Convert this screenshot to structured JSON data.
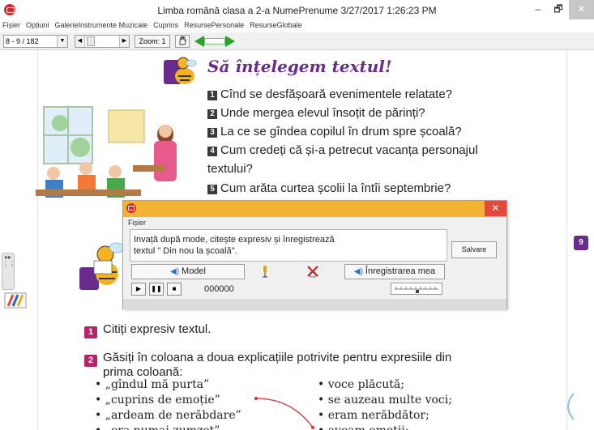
{
  "window": {
    "title": "Limba română clasa a 2-a   NumePrenume  3/27/2017 1:26:23 PM",
    "min": "–",
    "max": "🗗",
    "close": "✕"
  },
  "menu": [
    "Fișier",
    "Opțiuni",
    "GalerieInstrumente Muzicale",
    "Cuprins",
    "ResursePersonale",
    "ResurseGlobale"
  ],
  "toolbar": {
    "page_select": "8 - 9 / 182",
    "zoom": "Zoom: 1"
  },
  "page": {
    "heading": "Să înțelegem textul!",
    "questions": [
      {
        "num": "1",
        "text": "Cînd se desfășoară evenimentele relatate?"
      },
      {
        "num": "2",
        "text": "Unde mergea elevul însoțit de părinți?"
      },
      {
        "num": "3",
        "text": "La ce se gîndea copilul în drum spre școală?"
      },
      {
        "num": "4",
        "text": "Cum credeți că și-a petrecut vacanța personajul"
      },
      {
        "num": "",
        "text": "textului?"
      },
      {
        "num": "5",
        "text": "Cum arăta curtea școlii la întîi septembrie?"
      }
    ],
    "task1": {
      "num": "1",
      "text": "Citiți expresiv textul."
    },
    "task2": {
      "num": "2",
      "line1": "Găsiți în coloana a doua explicațiile potrivite pentru expresiile din",
      "line2": "prima coloană:"
    },
    "left_list": [
      "• „gîndul mă purta”",
      "• „cuprins de emoție”",
      "• „ardeam de nerăbdare”",
      "• „era numai zumzet”"
    ],
    "right_list": [
      "• voce plăcută;",
      "• se auzeau multe voci;",
      "• eram nerăbdător;",
      "• aveam emoții;"
    ]
  },
  "side": {
    "badge": "9"
  },
  "dialog": {
    "menu": "Fișier",
    "instruction_line1": "Invață după mode, citește expresiv și înregistrează",
    "instruction_line2": "textul \" Din nou la școală\".",
    "save": "Salvare",
    "model": "Model",
    "record": "Înregistrarea mea",
    "counter": "000000",
    "close": "✕"
  },
  "colors": {
    "heading": "#6a2c8c",
    "dialog_title": "#f2b334",
    "accent_green": "#28a428",
    "task_icon": "#b7236a"
  }
}
